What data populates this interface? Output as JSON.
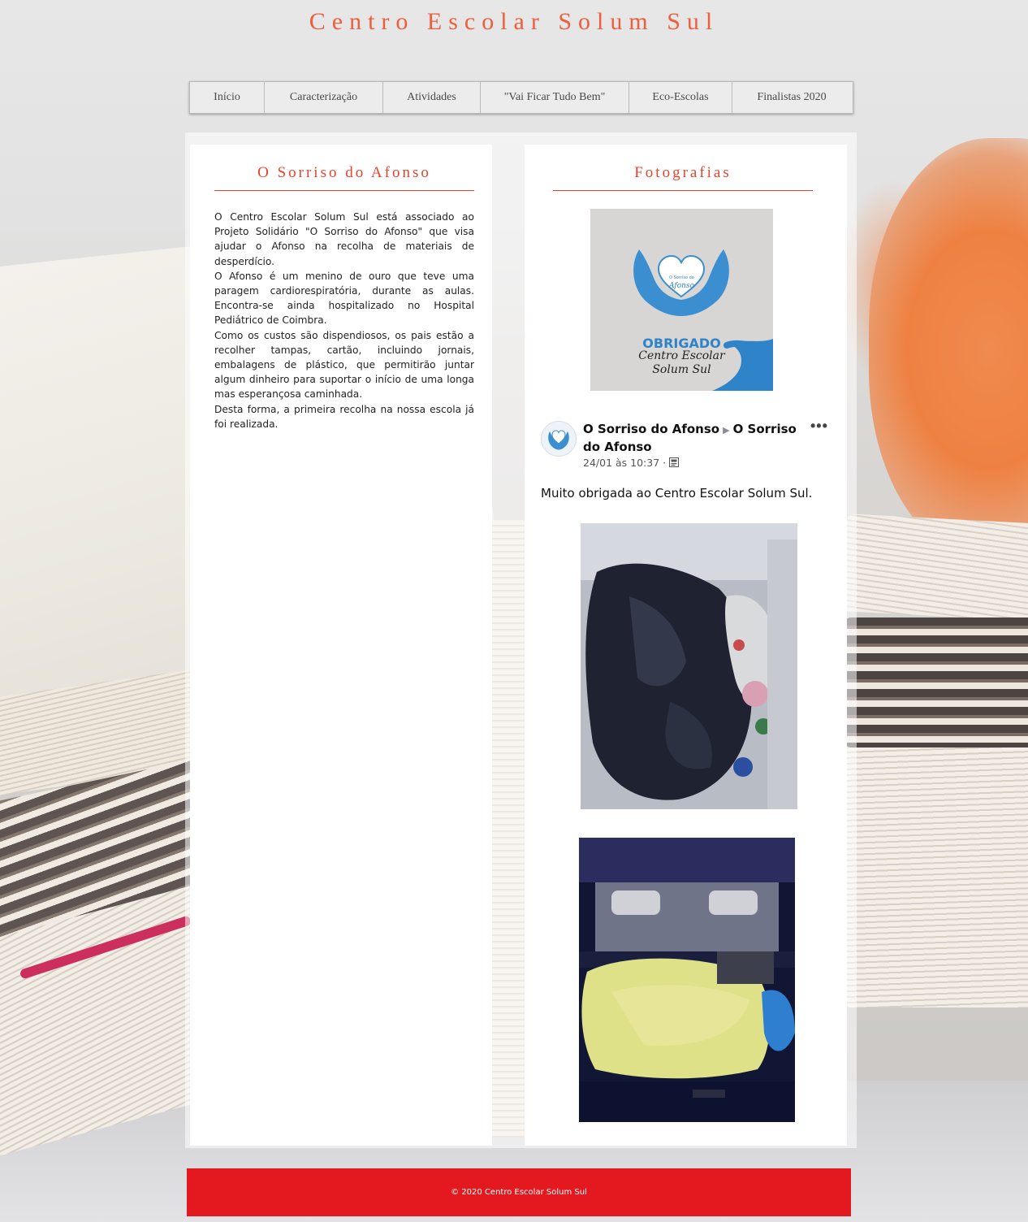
{
  "site": {
    "title": "Centro Escolar Solum Sul"
  },
  "nav": {
    "items": [
      {
        "label": "Início"
      },
      {
        "label": "Caracterização"
      },
      {
        "label": "Atividades"
      },
      {
        "label": "\"Vai Ficar Tudo Bem\""
      },
      {
        "label": "Eco-Escolas"
      },
      {
        "label": "Finalistas 2020"
      }
    ]
  },
  "left_panel": {
    "title": "O Sorriso do Afonso",
    "paragraphs": [
      "O Centro Escolar Solum Sul está associado ao Projeto Solidário \"O Sorriso do Afonso\" que visa ajudar o Afonso na recolha de materiais de desperdício.",
      "O Afonso é um menino de ouro que teve uma paragem cardiorespiratória, durante as aulas. Encontra-se ainda hospitalizado no Hospital Pediátrico de Coimbra.",
      "Como os custos são dispendiosos, os pais estão a recolher tampas, cartão, incluindo jornais, embalagens de plástico, que permitirão juntar algum dinheiro para suportar o início de uma longa mas esperançosa caminhada.",
      "Desta forma, a primeira recolha na nossa escola já foi realizada."
    ]
  },
  "right_panel": {
    "title": "Fotografias",
    "obrigado_card": {
      "heading": "OBRIGADO",
      "line1": "Centro Escolar",
      "line2": "Solum Sul",
      "logo_line1": "O Sorriso do",
      "logo_line2": "Afonso"
    },
    "post": {
      "author": "O Sorriso do Afonso",
      "target_line1": "O Sorriso",
      "target_line2": "do Afonso",
      "arrow": "▶",
      "more": "•••",
      "time": "24/01 às 10:37 ·",
      "text": "Muito obrigada ao Centro Escolar Solum Sul."
    }
  },
  "footer": {
    "text": "© 2020 Centro Escolar Solum Sul"
  },
  "colors": {
    "accent": "#e5432d",
    "footer_red": "#e3191f",
    "logo_blue": "#2f83c8"
  }
}
